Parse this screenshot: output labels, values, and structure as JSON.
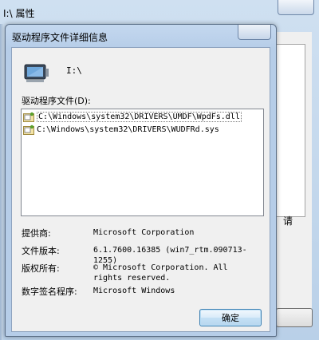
{
  "background_window": {
    "title": "I:\\ 属性",
    "side_text": "请"
  },
  "dialog": {
    "title": "驱动程序文件详细信息",
    "device_name": "I:\\",
    "files_label": "驱动程序文件(D):",
    "files": [
      "C:\\Windows\\system32\\DRIVERS\\UMDF\\WpdFs.dll",
      "C:\\Windows\\system32\\DRIVERS\\WUDFRd.sys"
    ],
    "info": {
      "provider_label": "提供商:",
      "provider_value": "Microsoft Corporation",
      "version_label": "文件版本:",
      "version_value": "6.1.7600.16385 (win7_rtm.090713-1255)",
      "copyright_label": "版权所有:",
      "copyright_value": "© Microsoft Corporation. All rights reserved.",
      "signer_label": "数字签名程序:",
      "signer_value": "Microsoft Windows"
    },
    "ok_label": "确定"
  },
  "colors": {
    "title_bar": "#c4d8ef",
    "body": "#f0f0f0",
    "ok_border": "#3c7fb1"
  },
  "icons": [
    "drive-icon",
    "file-icon",
    "folder-icon"
  ]
}
